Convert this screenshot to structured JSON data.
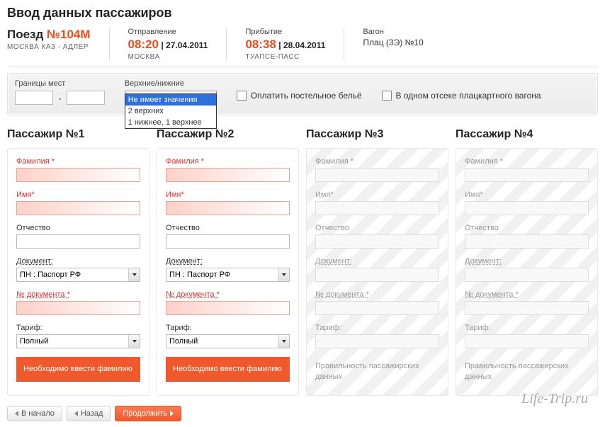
{
  "page_title": "Ввод данных пассажиров",
  "train": {
    "label": "Поезд",
    "number": "№104М",
    "route": "МОСКВА КАЗ - АДЛЕР"
  },
  "departure": {
    "label": "Отправление",
    "time": "08:20",
    "date": "27.04.2011",
    "station": "МОСКВА"
  },
  "arrival": {
    "label": "Прибытие",
    "time": "08:38",
    "date": "28.04.2011",
    "station": "ТУАПСЕ-ПАСС"
  },
  "car": {
    "label": "Вагон",
    "value": "Плац (3Э) №10"
  },
  "options": {
    "seat_bounds_label": "Границы мест",
    "dash": "-",
    "position_label": "Верхние/нижние",
    "position_selected": "Не имеет значения",
    "position_items": [
      "Не имеет значения",
      "2 верхних",
      "1 нижнее, 1 верхнее"
    ],
    "linen_label": "Оплатить постельное бельё",
    "same_compartment_label": "В одном отсеке плацкартного вагона"
  },
  "passenger_label_prefix": "Пассажир №",
  "passengers": [
    {
      "title": "Пассажир №1",
      "active": true
    },
    {
      "title": "Пассажир №2",
      "active": true
    },
    {
      "title": "Пассажир №3",
      "active": false
    },
    {
      "title": "Пассажир №4",
      "active": false
    }
  ],
  "field_labels": {
    "surname": "Фамилия",
    "name": "Имя",
    "patronymic": "Отчество",
    "document": "Документ:",
    "doc_number": "№ документа",
    "tariff": "Тариф:",
    "asterisk": "*"
  },
  "defaults": {
    "document": "ПН : Паспорт РФ",
    "tariff": "Полный"
  },
  "warning_text": "Необходимо ввести фамилию",
  "inactive_note": "Правильность пассажирских данных",
  "nav": {
    "start": "В начало",
    "back": "Назад",
    "continue": "Продолжить"
  },
  "watermark": "Life-Trip.ru"
}
